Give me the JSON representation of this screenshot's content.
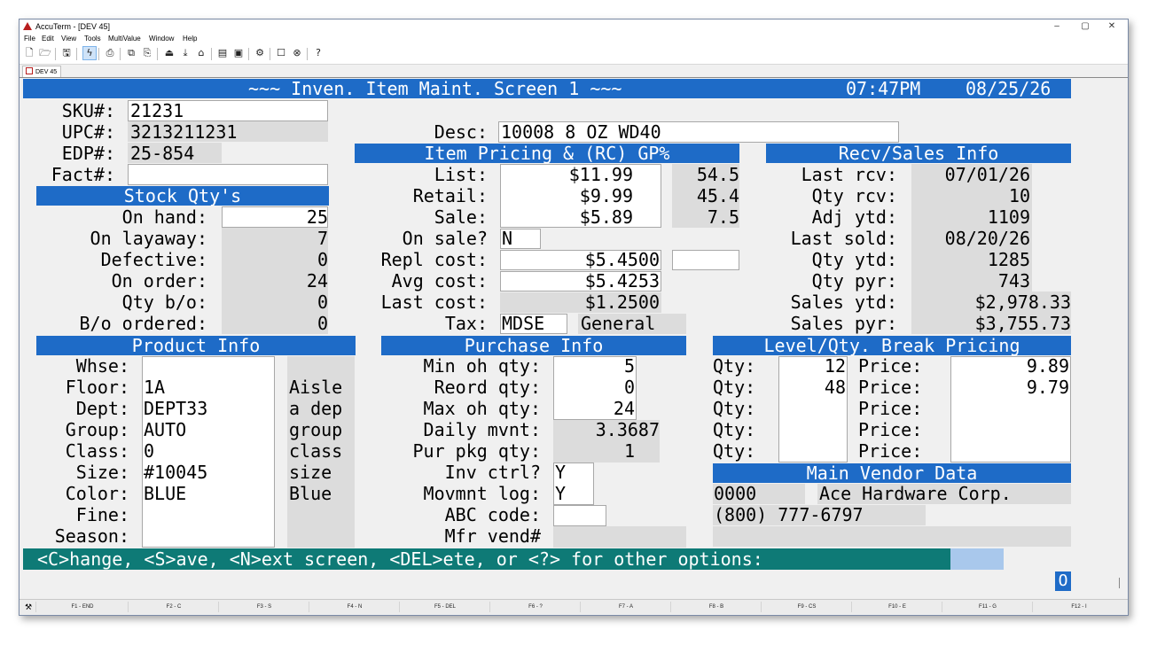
{
  "window": {
    "title": "AccuTerm - [DEV 45]",
    "controls": [
      "–",
      "▢",
      "✕"
    ]
  },
  "menu": [
    "File",
    "Edit",
    "View",
    "Tools",
    "MultiValue",
    "Window",
    "Help"
  ],
  "toolbar_icons": [
    "new-file-icon",
    "open-folder-icon",
    "save-icon",
    "connect-lightning-icon",
    "print-icon",
    "copy-icon",
    "paste-icon",
    "upload-icon",
    "download-icon",
    "disconnect-icon",
    "script-icon",
    "capture-icon",
    "settings-gear-icon",
    "maximize-square-icon",
    "stop-circle-icon",
    "help-question-icon"
  ],
  "tab": {
    "label": "DEV 45"
  },
  "screen": {
    "title": "~~~ Inven. Item Maint. Screen 1 ~~~",
    "time": "07:47PM",
    "date": "08/25/26",
    "sku": {
      "label": "SKU#:",
      "value": "21231"
    },
    "upc": {
      "label": "UPC#:",
      "value": "3213211231"
    },
    "edp": {
      "label": "EDP#:",
      "value": "25-854"
    },
    "fact": {
      "label": "Fact#:",
      "value": ""
    },
    "desc": {
      "label": "Desc:",
      "value": "10008 8 OZ WD40"
    },
    "stock": {
      "header": "Stock Qty's",
      "rows": [
        {
          "label": "On hand:",
          "value": "25"
        },
        {
          "label": "On layaway:",
          "value": "7"
        },
        {
          "label": "Defective:",
          "value": "0"
        },
        {
          "label": "On order:",
          "value": "24"
        },
        {
          "label": "Qty b/o:",
          "value": "0"
        },
        {
          "label": "B/o ordered:",
          "value": "0"
        }
      ]
    },
    "pricing": {
      "header": "Item Pricing & (RC) GP%",
      "list": {
        "label": "List:",
        "value": "$11.99",
        "gp": "54.5"
      },
      "retail": {
        "label": "Retail:",
        "value": "$9.99",
        "gp": "45.4"
      },
      "sale": {
        "label": "Sale:",
        "value": "$5.89",
        "gp": "7.5"
      },
      "on_sale": {
        "label": "On sale?",
        "value": "N"
      },
      "repl_cost": {
        "label": "Repl cost:",
        "value": "$5.4500",
        "extra": ""
      },
      "avg_cost": {
        "label": "Avg cost:",
        "value": "$5.4253"
      },
      "last_cost": {
        "label": "Last cost:",
        "value": "$1.2500"
      },
      "tax": {
        "label": "Tax:",
        "code": "MDSE",
        "desc": "General"
      }
    },
    "recv": {
      "header": "Recv/Sales Info",
      "rows": [
        {
          "label": "Last rcv:",
          "value": "07/01/26"
        },
        {
          "label": "Qty rcv:",
          "value": "10"
        },
        {
          "label": "Adj ytd:",
          "value": "1109"
        },
        {
          "label": "Last sold:",
          "value": "08/20/26"
        },
        {
          "label": "Qty ytd:",
          "value": "1285"
        },
        {
          "label": "Qty pyr:",
          "value": "743"
        },
        {
          "label": "Sales ytd:",
          "value": "$2,978.33"
        },
        {
          "label": "Sales pyr:",
          "value": "$3,755.73"
        }
      ]
    },
    "product": {
      "header": "Product Info",
      "rows": [
        {
          "label": "Whse:",
          "value": "",
          "desc": ""
        },
        {
          "label": "Floor:",
          "value": "1A",
          "desc": "Aisle"
        },
        {
          "label": "Dept:",
          "value": "DEPT33",
          "desc": "a dep"
        },
        {
          "label": "Group:",
          "value": "AUTO",
          "desc": "group"
        },
        {
          "label": "Class:",
          "value": "0",
          "desc": "class"
        },
        {
          "label": "Size:",
          "value": "#10045",
          "desc": "size"
        },
        {
          "label": "Color:",
          "value": "BLUE",
          "desc": "Blue"
        },
        {
          "label": "Fine:",
          "value": "",
          "desc": ""
        },
        {
          "label": "Season:",
          "value": "",
          "desc": ""
        }
      ]
    },
    "purchase": {
      "header": "Purchase Info",
      "rows": [
        {
          "label": "Min oh qty:",
          "value": "5"
        },
        {
          "label": "Reord qty:",
          "value": "0"
        },
        {
          "label": "Max oh qty:",
          "value": "24"
        },
        {
          "label": "Daily mvnt:",
          "value": "3.3687"
        },
        {
          "label": "Pur pkg qty:",
          "value": "1"
        },
        {
          "label": "Inv ctrl?",
          "value": "Y"
        },
        {
          "label": "Movmnt log:",
          "value": "Y"
        },
        {
          "label": "ABC code:",
          "value": ""
        },
        {
          "label": "Mfr vend#",
          "value": ""
        }
      ]
    },
    "level": {
      "header": "Level/Qty. Break Pricing",
      "qty_label": "Qty:",
      "price_label": "Price:",
      "rows": [
        {
          "qty": "12",
          "price": "9.89"
        },
        {
          "qty": "48",
          "price": "9.79"
        },
        {
          "qty": "",
          "price": ""
        },
        {
          "qty": "",
          "price": ""
        },
        {
          "qty": "",
          "price": ""
        }
      ]
    },
    "vendor": {
      "header": "Main Vendor Data",
      "code": "0000",
      "name": "Ace Hardware Corp.",
      "phone": "(800) 777-6797",
      "extra": ""
    },
    "prompt": "<C>hange, <S>ave, <N>ext screen, <DEL>ete, or <?> for other options:",
    "status_char": "O"
  },
  "fkeys": [
    "F1 - END",
    "F2 - C",
    "F3 - S",
    "F4 - N",
    "F5 - DEL",
    "F6 - ?",
    "F7 - A",
    "F8 - B",
    "F9 - CS",
    "F10 - E",
    "F11 - G",
    "F12 - I"
  ],
  "colors": {
    "header_blue": "#1e6bc7",
    "prompt_teal": "#0e7a76",
    "field_gray": "#dcdcdc"
  }
}
